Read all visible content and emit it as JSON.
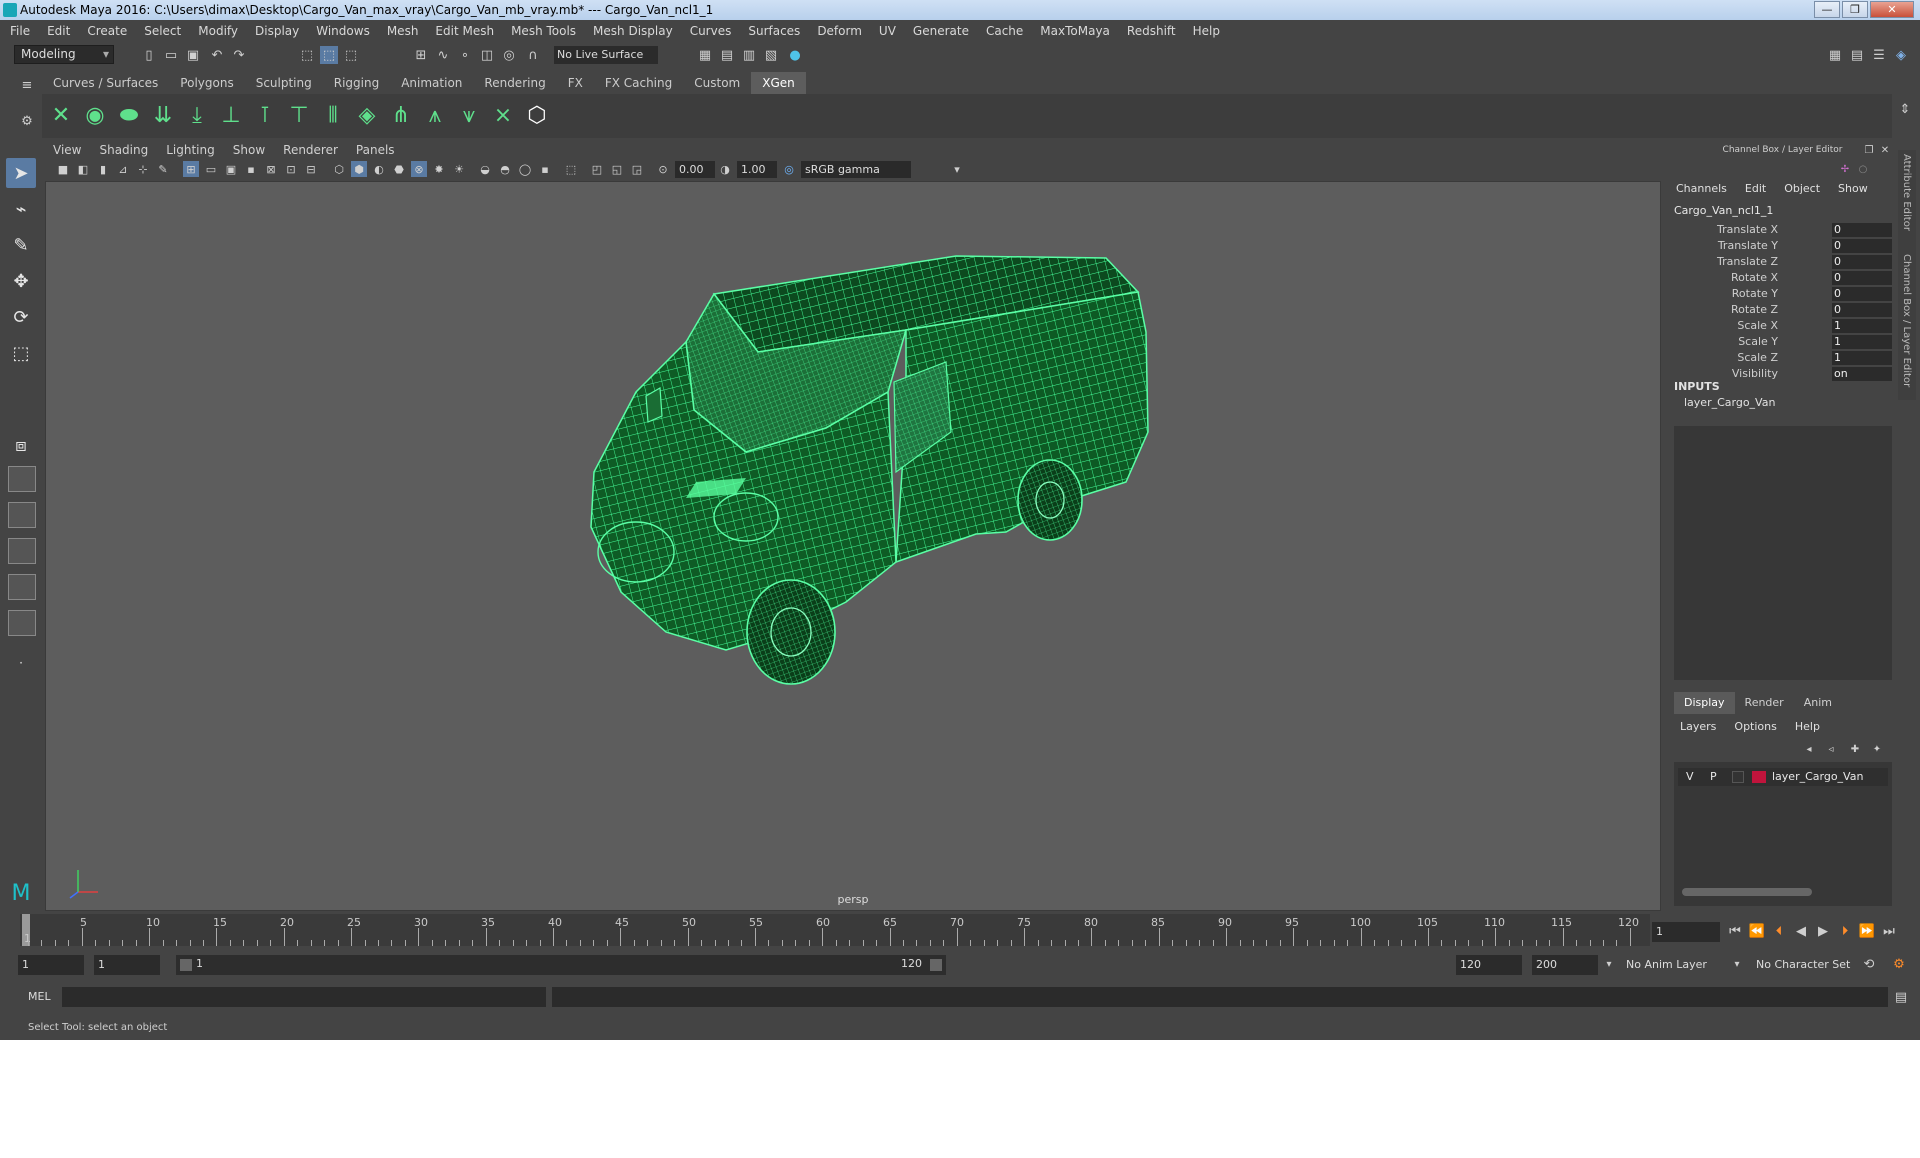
{
  "title": "Autodesk Maya 2016: C:\\Users\\dimax\\Desktop\\Cargo_Van_max_vray\\Cargo_Van_mb_vray.mb*   ---   Cargo_Van_ncl1_1",
  "window_buttons": [
    "—",
    "❐",
    "✕"
  ],
  "menu": [
    "File",
    "Edit",
    "Create",
    "Select",
    "Modify",
    "Display",
    "Windows",
    "Mesh",
    "Edit Mesh",
    "Mesh Tools",
    "Mesh Display",
    "Curves",
    "Surfaces",
    "Deform",
    "UV",
    "Generate",
    "Cache",
    "MaxToMaya",
    "Redshift",
    "Help"
  ],
  "mode": "Modeling",
  "live_surface": "No Live Surface",
  "shelf_tabs": [
    "Curves / Surfaces",
    "Polygons",
    "Sculpting",
    "Rigging",
    "Animation",
    "Rendering",
    "FX",
    "FX Caching",
    "Custom",
    "XGen"
  ],
  "active_shelf_tab": "XGen",
  "viewport": {
    "menu": [
      "View",
      "Shading",
      "Lighting",
      "Show",
      "Renderer",
      "Panels"
    ],
    "exposure": "0.00",
    "gamma": "1.00",
    "color_space": "sRGB gamma",
    "camera_label": "persp"
  },
  "channel_box": {
    "title": "Channel Box / Layer Editor",
    "menu": [
      "Channels",
      "Edit",
      "Object",
      "Show"
    ],
    "object_name": "Cargo_Van_ncl1_1",
    "attributes": [
      {
        "label": "Translate X",
        "value": "0"
      },
      {
        "label": "Translate Y",
        "value": "0"
      },
      {
        "label": "Translate Z",
        "value": "0"
      },
      {
        "label": "Rotate X",
        "value": "0"
      },
      {
        "label": "Rotate Y",
        "value": "0"
      },
      {
        "label": "Rotate Z",
        "value": "0"
      },
      {
        "label": "Scale X",
        "value": "1"
      },
      {
        "label": "Scale Y",
        "value": "1"
      },
      {
        "label": "Scale Z",
        "value": "1"
      },
      {
        "label": "Visibility",
        "value": "on"
      }
    ],
    "inputs_header": "INPUTS",
    "inputs_item": "layer_Cargo_Van"
  },
  "layer_editor": {
    "tabs": [
      "Display",
      "Render",
      "Anim"
    ],
    "active_tab": "Display",
    "menu": [
      "Layers",
      "Options",
      "Help"
    ],
    "layer": {
      "v": "V",
      "p": "P",
      "name": "layer_Cargo_Van",
      "color": "#c0143c"
    }
  },
  "side_tabs": [
    "Attribute Editor",
    "Channel Box / Layer Editor"
  ],
  "timeline": {
    "labels": [
      "1",
      "5",
      "10",
      "15",
      "20",
      "25",
      "30",
      "35",
      "40",
      "45",
      "50",
      "55",
      "60",
      "65",
      "70",
      "75",
      "80",
      "85",
      "90",
      "95",
      "100",
      "105",
      "110",
      "115",
      "120"
    ],
    "current_frame": "1"
  },
  "range": {
    "start": "1",
    "current": "1",
    "slider_start": "1",
    "slider_end": "120",
    "end": "120",
    "max_end": "200",
    "anim_layer": "No Anim Layer",
    "character_set": "No Character Set"
  },
  "command": {
    "label": "MEL"
  },
  "help_text": "Select Tool: select an object",
  "colors": {
    "wireframe": "#33ff88",
    "accent": "#5a7ba3",
    "layer_color": "#c0143c"
  }
}
